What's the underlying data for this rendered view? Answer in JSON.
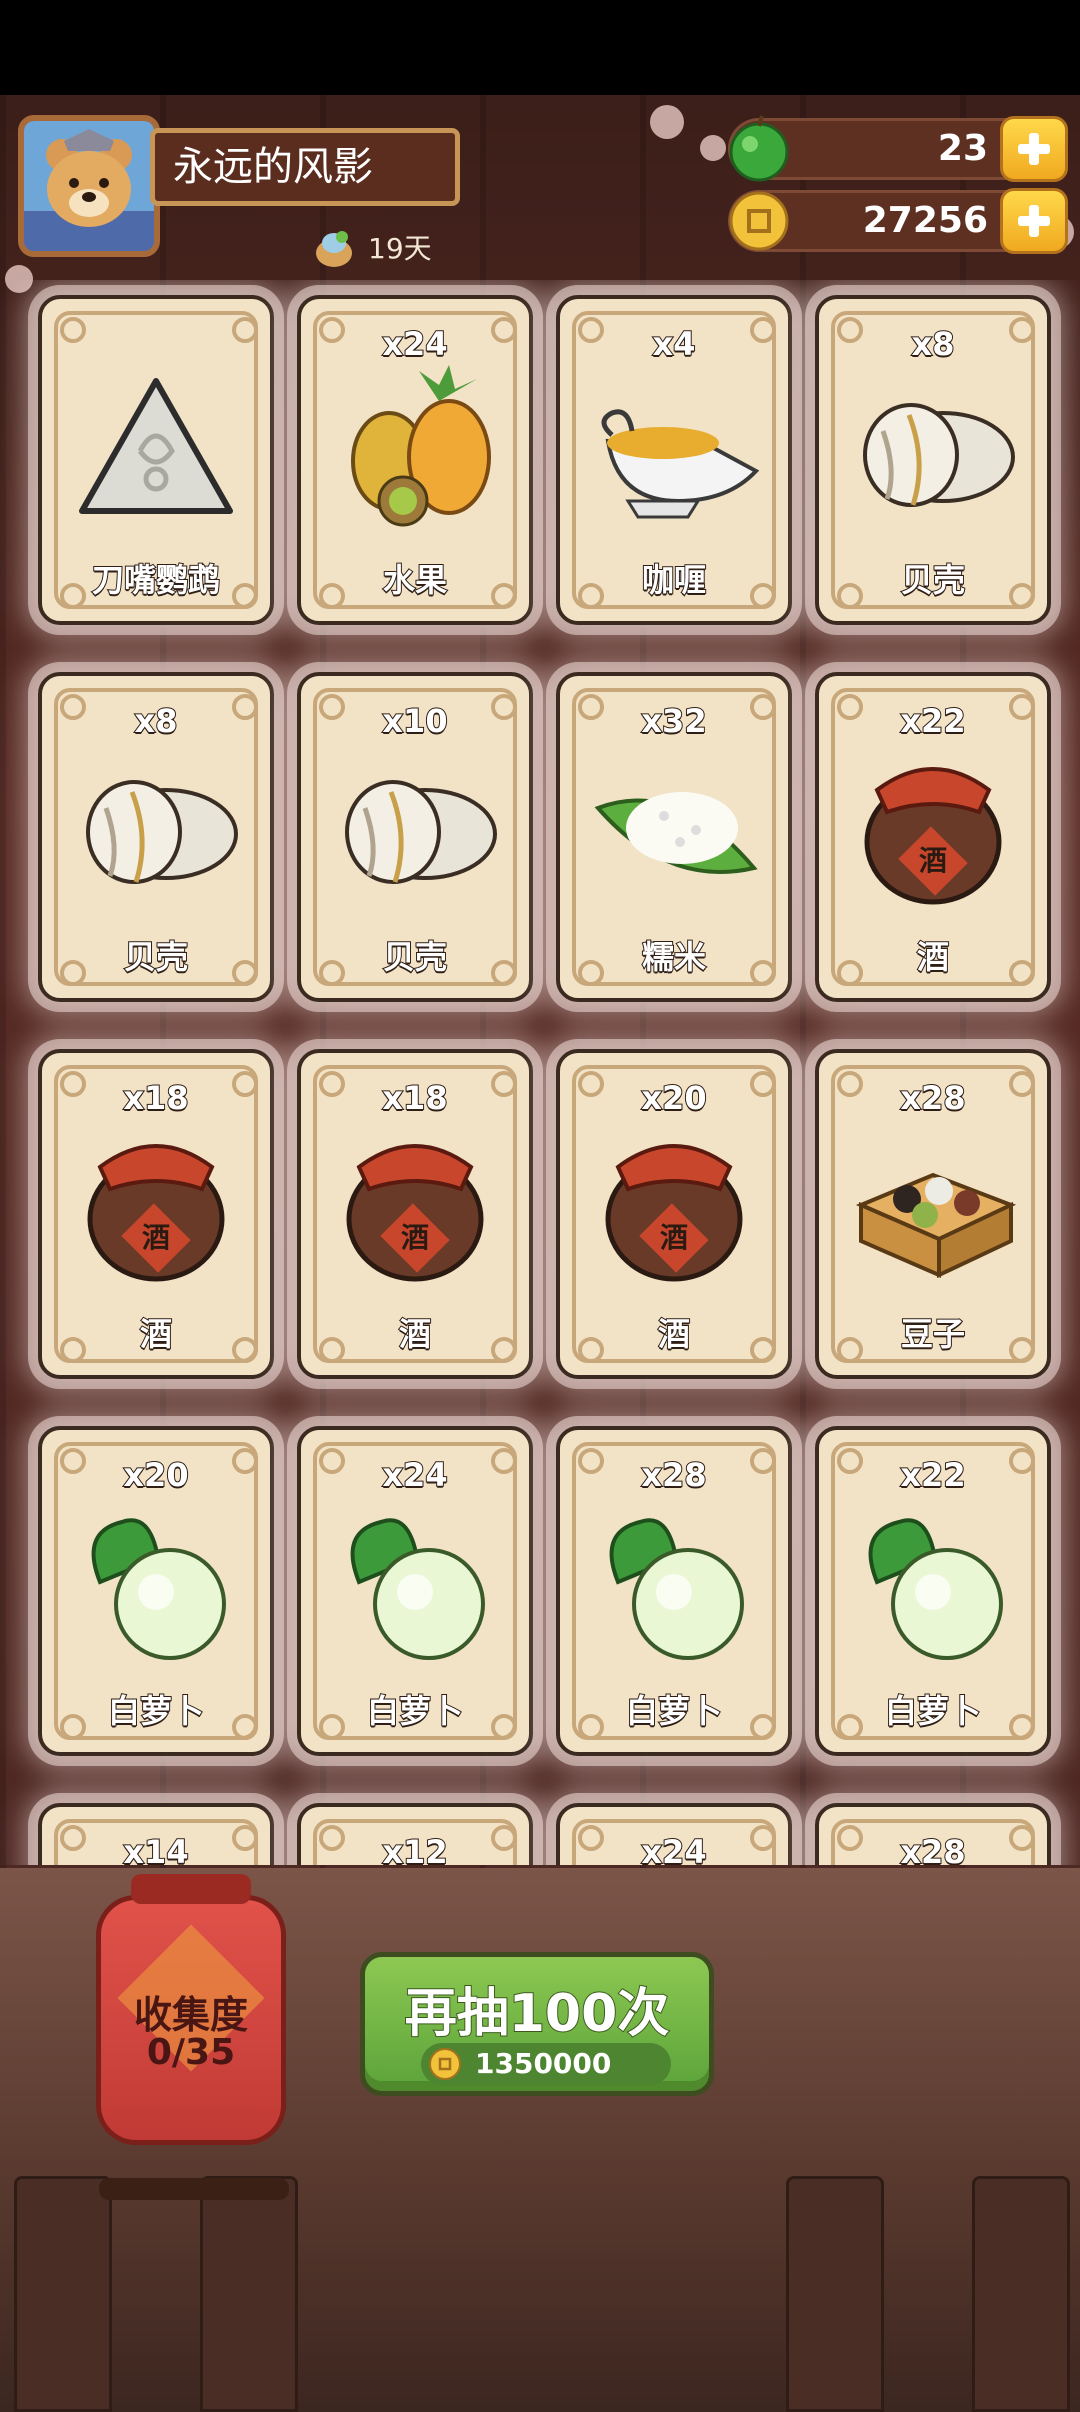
{
  "header": {
    "player_name": "永远的风影",
    "days": "19天"
  },
  "resources": {
    "apples": "23",
    "coins": "27256"
  },
  "cards": [
    {
      "count": "",
      "label": "刀嘴鹦鹉",
      "icon": "silver-shell-triangle-icon"
    },
    {
      "count": "x24",
      "label": "水果",
      "icon": "fruit-icon"
    },
    {
      "count": "x4",
      "label": "咖喱",
      "icon": "curry-gravy-boat-icon"
    },
    {
      "count": "x8",
      "label": "贝壳",
      "icon": "clam-shell-icon"
    },
    {
      "count": "x8",
      "label": "贝壳",
      "icon": "clam-shell-icon"
    },
    {
      "count": "x10",
      "label": "贝壳",
      "icon": "clam-shell-icon"
    },
    {
      "count": "x32",
      "label": "糯米",
      "icon": "rice-leaf-icon"
    },
    {
      "count": "x22",
      "label": "酒",
      "icon": "wine-jar-icon"
    },
    {
      "count": "x18",
      "label": "酒",
      "icon": "wine-jar-icon"
    },
    {
      "count": "x18",
      "label": "酒",
      "icon": "wine-jar-icon"
    },
    {
      "count": "x20",
      "label": "酒",
      "icon": "wine-jar-icon"
    },
    {
      "count": "x28",
      "label": "豆子",
      "icon": "bean-box-icon"
    },
    {
      "count": "x20",
      "label": "白萝卜",
      "icon": "white-radish-icon"
    },
    {
      "count": "x24",
      "label": "白萝卜",
      "icon": "white-radish-icon"
    },
    {
      "count": "x28",
      "label": "白萝卜",
      "icon": "white-radish-icon"
    },
    {
      "count": "x22",
      "label": "白萝卜",
      "icon": "white-radish-icon"
    },
    {
      "count": "x14",
      "label": "",
      "icon": ""
    },
    {
      "count": "x12",
      "label": "",
      "icon": ""
    },
    {
      "count": "x24",
      "label": "",
      "icon": ""
    },
    {
      "count": "x28",
      "label": "",
      "icon": ""
    }
  ],
  "collection": {
    "title": "收集度",
    "progress": "0/35"
  },
  "draw_button": {
    "label": "再抽100次",
    "cost": "1350000"
  },
  "colors": {
    "card_bg": "#f2e3c6",
    "button_green": "#6fb443",
    "lantern_red": "#d3463f",
    "plus_yellow": "#ffd84a"
  }
}
